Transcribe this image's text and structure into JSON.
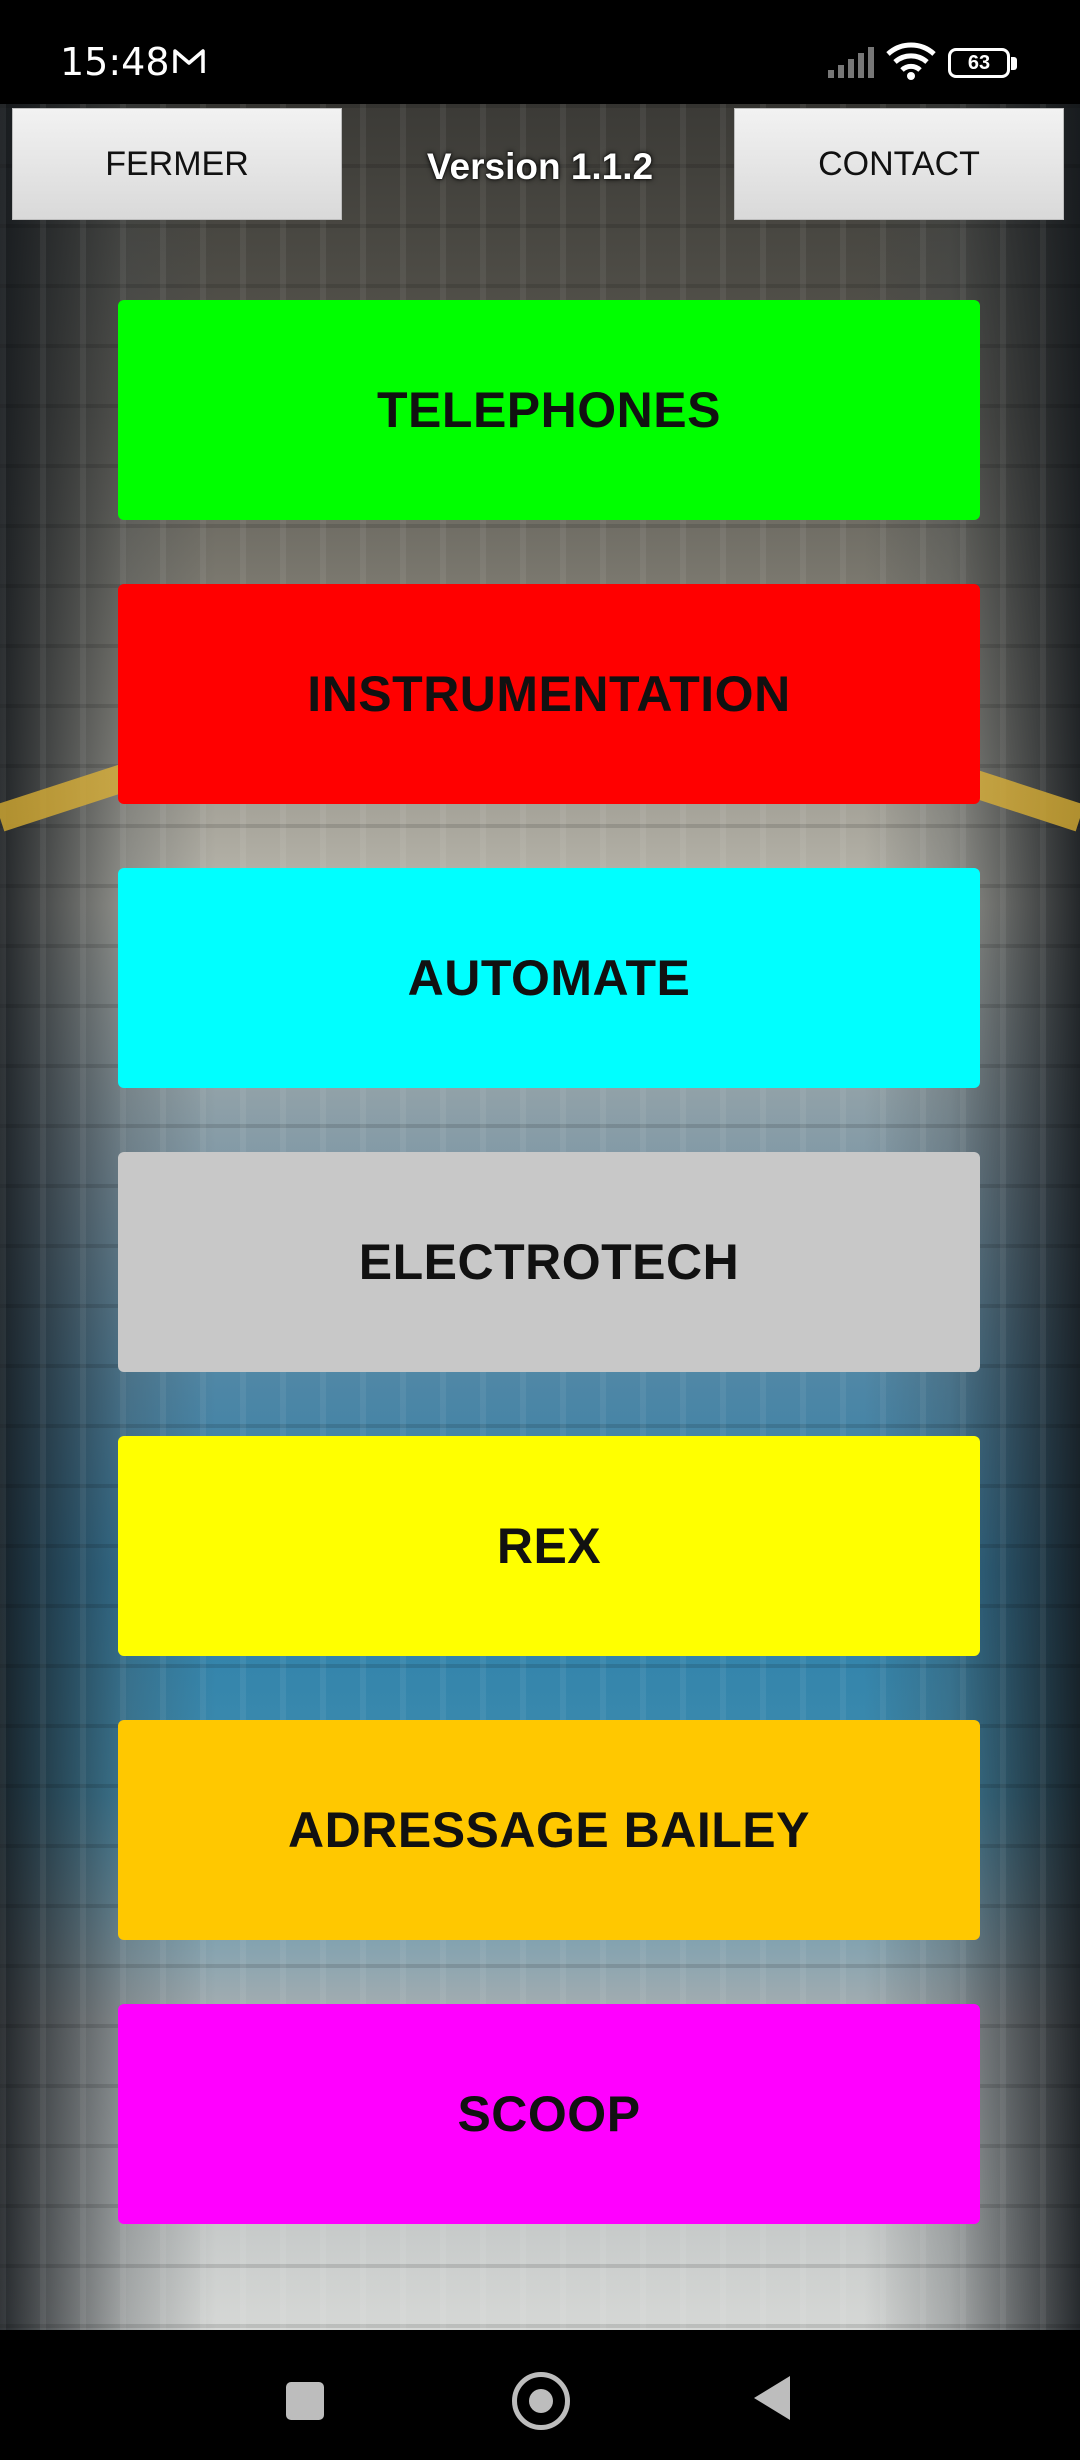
{
  "status_bar": {
    "time": "15:48",
    "battery": "63",
    "icons": [
      "gmail-icon",
      "signal-icon",
      "wifi-icon",
      "battery-icon"
    ]
  },
  "header": {
    "close_label": "FERMER",
    "version": "Version 1.1.2",
    "contact_label": "CONTACT"
  },
  "menu": [
    {
      "label": "TELEPHONES",
      "color": "#00ff00"
    },
    {
      "label": "INSTRUMENTATION",
      "color": "#ff0000"
    },
    {
      "label": "AUTOMATE",
      "color": "#00ffff"
    },
    {
      "label": "ELECTROTECH",
      "color": "#c8c8c8"
    },
    {
      "label": "REX",
      "color": "#ffff00"
    },
    {
      "label": "ADRESSAGE BAILEY",
      "color": "#ffc800"
    },
    {
      "label": "SCOOP",
      "color": "#ff00ff"
    }
  ],
  "nav_bar": {
    "icons": [
      "recents-icon",
      "home-icon",
      "back-icon"
    ]
  }
}
